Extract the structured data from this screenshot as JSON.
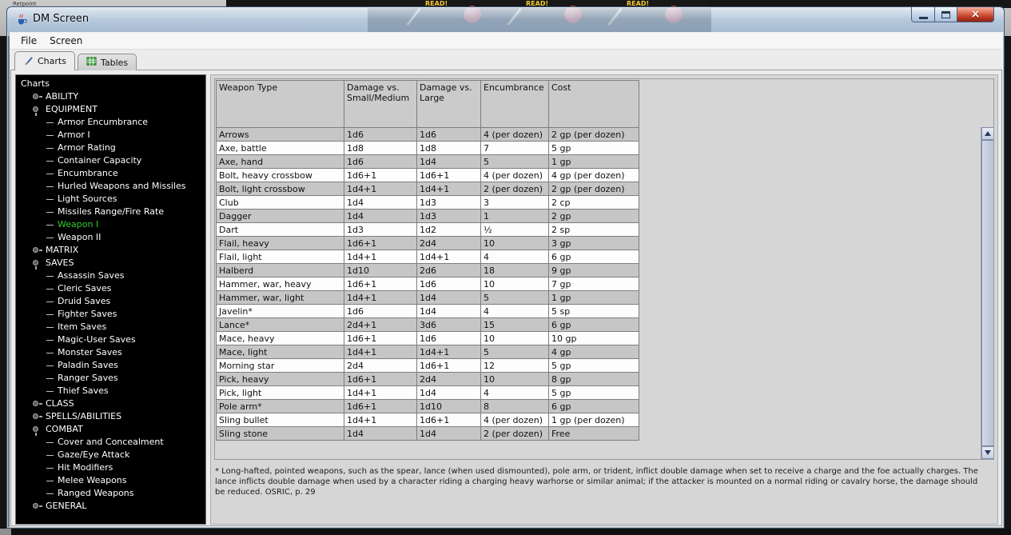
{
  "desktop": {
    "taskbar_text": "Retpoint",
    "ready_labels": [
      "READ!",
      "READ!",
      "READ!"
    ]
  },
  "window": {
    "title": "DM Screen",
    "controls": {
      "close_glyph": "×"
    }
  },
  "menu_bar": {
    "items": [
      "File",
      "Screen"
    ]
  },
  "tabs": [
    {
      "label": "Charts",
      "icon": "brush-icon",
      "selected": true
    },
    {
      "label": "Tables",
      "icon": "table-grid-icon",
      "selected": false
    }
  ],
  "tree": {
    "root_label": "Charts",
    "selected_item": "Weapon I",
    "items": [
      {
        "label": "ABILITY",
        "level": 1,
        "type": "branch",
        "expanded": false
      },
      {
        "label": "EQUIPMENT",
        "level": 1,
        "type": "branch",
        "expanded": true
      },
      {
        "label": "Armor Encumbrance",
        "level": 2,
        "type": "leaf"
      },
      {
        "label": "Armor I",
        "level": 2,
        "type": "leaf"
      },
      {
        "label": "Armor Rating",
        "level": 2,
        "type": "leaf"
      },
      {
        "label": "Container Capacity",
        "level": 2,
        "type": "leaf"
      },
      {
        "label": "Encumbrance",
        "level": 2,
        "type": "leaf"
      },
      {
        "label": "Hurled Weapons and Missiles",
        "level": 2,
        "type": "leaf"
      },
      {
        "label": "Light Sources",
        "level": 2,
        "type": "leaf"
      },
      {
        "label": "Missiles Range/Fire Rate",
        "level": 2,
        "type": "leaf"
      },
      {
        "label": "Weapon I",
        "level": 2,
        "type": "leaf",
        "selected": true
      },
      {
        "label": "Weapon II",
        "level": 2,
        "type": "leaf"
      },
      {
        "label": "MATRIX",
        "level": 1,
        "type": "branch",
        "expanded": false
      },
      {
        "label": "SAVES",
        "level": 1,
        "type": "branch",
        "expanded": true
      },
      {
        "label": "Assassin Saves",
        "level": 2,
        "type": "leaf"
      },
      {
        "label": "Cleric Saves",
        "level": 2,
        "type": "leaf"
      },
      {
        "label": "Druid Saves",
        "level": 2,
        "type": "leaf"
      },
      {
        "label": "Fighter Saves",
        "level": 2,
        "type": "leaf"
      },
      {
        "label": "Item Saves",
        "level": 2,
        "type": "leaf"
      },
      {
        "label": "Magic-User Saves",
        "level": 2,
        "type": "leaf"
      },
      {
        "label": "Monster Saves",
        "level": 2,
        "type": "leaf"
      },
      {
        "label": "Paladin Saves",
        "level": 2,
        "type": "leaf"
      },
      {
        "label": "Ranger Saves",
        "level": 2,
        "type": "leaf"
      },
      {
        "label": "Thief Saves",
        "level": 2,
        "type": "leaf"
      },
      {
        "label": "CLASS",
        "level": 1,
        "type": "branch",
        "expanded": false
      },
      {
        "label": "SPELLS/ABILITIES",
        "level": 1,
        "type": "branch",
        "expanded": false
      },
      {
        "label": "COMBAT",
        "level": 1,
        "type": "branch",
        "expanded": true
      },
      {
        "label": "Cover and Concealment",
        "level": 2,
        "type": "leaf"
      },
      {
        "label": "Gaze/Eye Attack",
        "level": 2,
        "type": "leaf"
      },
      {
        "label": "Hit Modifiers",
        "level": 2,
        "type": "leaf"
      },
      {
        "label": "Melee Weapons",
        "level": 2,
        "type": "leaf"
      },
      {
        "label": "Ranged Weapons",
        "level": 2,
        "type": "leaf"
      },
      {
        "label": "GENERAL",
        "level": 1,
        "type": "branch",
        "expanded": false
      }
    ]
  },
  "table": {
    "headers": [
      "Weapon Type",
      "Damage vs. Small/Medium",
      "Damage vs. Large",
      "Encumbrance",
      "Cost"
    ],
    "rows": [
      [
        "Arrows",
        "1d6",
        "1d6",
        "4 (per dozen)",
        "2 gp (per dozen)"
      ],
      [
        "Axe, battle",
        "1d8",
        "1d8",
        "7",
        "5 gp"
      ],
      [
        "Axe, hand",
        "1d6",
        "1d4",
        "5",
        "1 gp"
      ],
      [
        "Bolt, heavy crossbow",
        "1d6+1",
        "1d6+1",
        "4 (per dozen)",
        "4 gp (per dozen)"
      ],
      [
        "Bolt, light crossbow",
        "1d4+1",
        "1d4+1",
        "2 (per dozen)",
        "2 gp (per dozen)"
      ],
      [
        "Club",
        "1d4",
        "1d3",
        "3",
        "2 cp"
      ],
      [
        "Dagger",
        "1d4",
        "1d3",
        "1",
        "2 gp"
      ],
      [
        "Dart",
        "1d3",
        "1d2",
        "½",
        "2 sp"
      ],
      [
        "Flail, heavy",
        "1d6+1",
        "2d4",
        "10",
        "3 gp"
      ],
      [
        "Flail, light",
        "1d4+1",
        "1d4+1",
        "4",
        "6 gp"
      ],
      [
        "Halberd",
        "1d10",
        "2d6",
        "18",
        "9 gp"
      ],
      [
        "Hammer, war, heavy",
        "1d6+1",
        "1d6",
        "10",
        "7 gp"
      ],
      [
        "Hammer, war, light",
        "1d4+1",
        "1d4",
        "5",
        "1 gp"
      ],
      [
        "Javelin*",
        "1d6",
        "1d4",
        "4",
        "5 sp"
      ],
      [
        "Lance*",
        "2d4+1",
        "3d6",
        "15",
        "6 gp"
      ],
      [
        "Mace, heavy",
        "1d6+1",
        "1d6",
        "10",
        "10 gp"
      ],
      [
        "Mace, light",
        "1d4+1",
        "1d4+1",
        "5",
        "4 gp"
      ],
      [
        "Morning star",
        "2d4",
        "1d6+1",
        "12",
        "5 gp"
      ],
      [
        "Pick, heavy",
        "1d6+1",
        "2d4",
        "10",
        "8 gp"
      ],
      [
        "Pick, light",
        "1d4+1",
        "1d4",
        "4",
        "5 gp"
      ],
      [
        "Pole arm*",
        "1d6+1",
        "1d10",
        "8",
        "6 gp"
      ],
      [
        "Sling bullet",
        "1d4+1",
        "1d6+1",
        "4 (per dozen)",
        "1 gp (per dozen)"
      ],
      [
        "Sling stone",
        "1d4",
        "1d4",
        "2 (per dozen)",
        "Free"
      ]
    ]
  },
  "footnote": {
    "text": "* Long-hafted, pointed weapons, such as the spear, lance (when used dismounted), pole arm, or trident, inflict double damage when set to receive a charge and the foe actually charges. The lance inflicts double damage when used by a character riding a charging heavy warhorse or similar animal; if the attacker is mounted on a normal riding or cavalry horse, the damage should be reduced. OSRIC, p. 29"
  },
  "colors": {
    "tree_background": "#000000",
    "tree_text": "#FFFFFF",
    "selected_tree_item": "#33CC33",
    "row_stripe_gray": "#C6C6C6",
    "ready_button_red": "#CC2A1A",
    "close_button_red": "#C23B2A",
    "titlebar_glass": "#BCD0E8"
  }
}
